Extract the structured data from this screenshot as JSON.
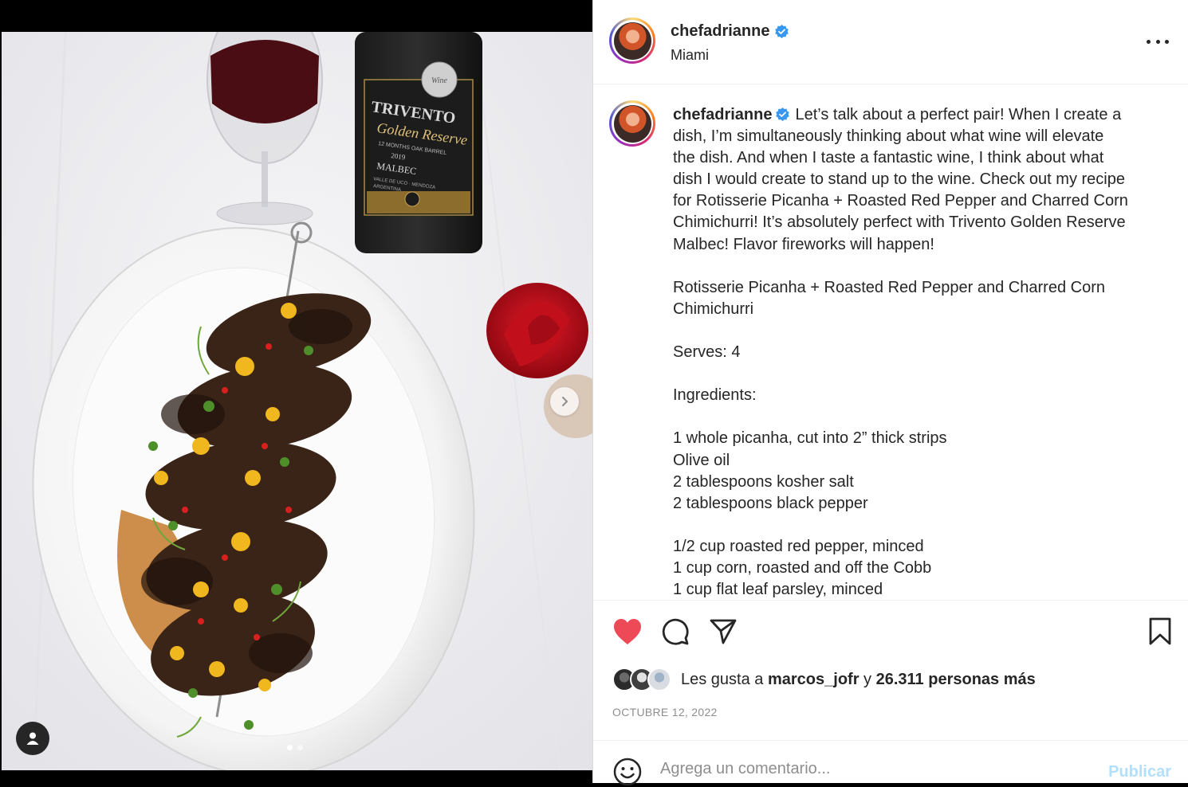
{
  "post": {
    "username": "chefadrianne",
    "location": "Miami",
    "caption_lines": [
      "Let’s talk about a perfect pair! When I create a",
      "dish, I’m simultaneously thinking about what wine will elevate",
      "the dish. And when I taste a fantastic wine, I think about what",
      "dish I would create to stand up to the wine. Check out my recipe",
      "for Rotisserie Picanha + Roasted Red Pepper and Charred Corn",
      "Chimichurri! It’s absolutely perfect with Trivento Golden Reserve",
      "Malbec! Flavor fireworks will happen!",
      "",
      "Rotisserie Picanha + Roasted Red Pepper and Charred Corn",
      "Chimichurri",
      "",
      "Serves: 4",
      "",
      "Ingredients:",
      "",
      "1 whole picanha, cut into 2” thick strips",
      "Olive oil",
      "2 tablespoons kosher salt",
      "2 tablespoons black pepper",
      "",
      "1/2 cup roasted red pepper, minced",
      "1 cup corn, roasted and off the Cobb",
      "1 cup flat leaf parsley, minced"
    ],
    "likes": {
      "prefix": "Les gusta a",
      "liker": "marcos_jofr",
      "connector": "y",
      "others": "26.311 personas más"
    },
    "date": "OCTUBRE 12, 2022",
    "liked": true
  },
  "photo": {
    "bottle_label": {
      "brand": "TRIVENTO",
      "line": "Golden Reserve",
      "barrel": "12 MONTHS OAK BARREL",
      "year": "2019",
      "variety": "MALBEC",
      "origin": "VALLE DE UCO · MENDOZA",
      "country": "ARGENTINA",
      "medal": "Wine"
    },
    "slide_count": 2,
    "active_slide": 0
  },
  "comment": {
    "placeholder": "Agrega un comentario...",
    "publish_label": "Publicar"
  },
  "colors": {
    "like_red": "#ed4956",
    "verified_blue": "#3897f0",
    "publish_disabled": "#b2dffc",
    "muted_text": "#8e8e8e"
  },
  "icons": {
    "like": "heart-filled-icon",
    "comment": "comment-bubble-icon",
    "share": "paper-plane-icon",
    "save": "bookmark-icon",
    "more": "more-horizontal-icon",
    "next": "chevron-right-icon",
    "tags": "user-tag-icon",
    "emoji": "emoji-smile-icon"
  }
}
